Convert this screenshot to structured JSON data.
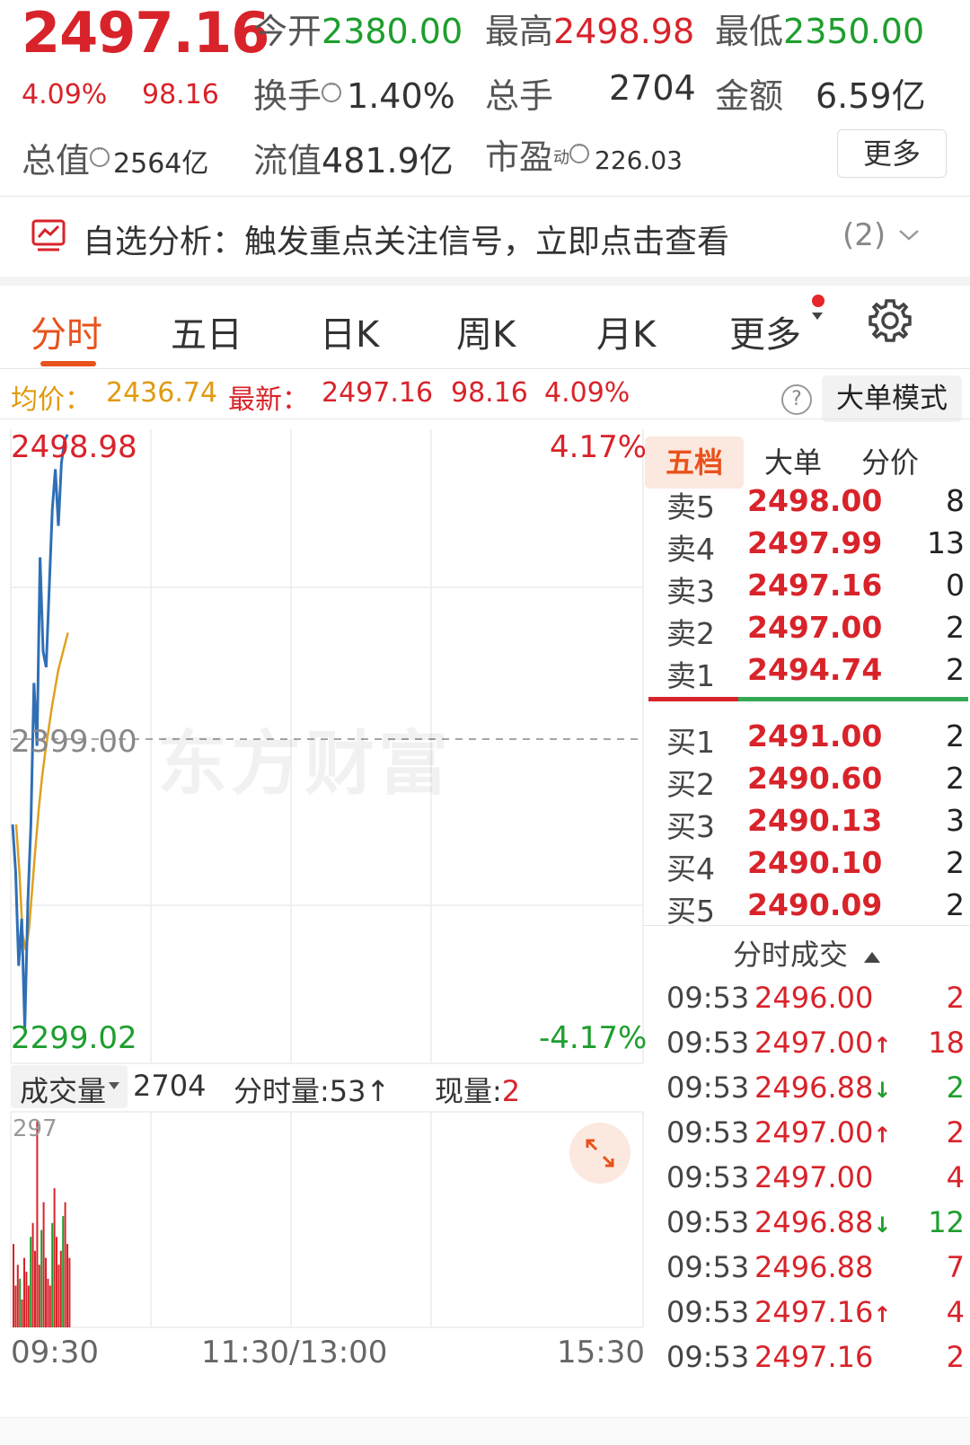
{
  "quote": {
    "price": "2497.16",
    "change_pct": "4.09%",
    "change_amt": "98.16",
    "open_label": "今开",
    "open_value": "2380.00",
    "high_label": "最高",
    "high_value": "2498.98",
    "low_label": "最低",
    "low_value": "2350.00",
    "turnover_label": "换手",
    "turnover_value": "1.40%",
    "volume_label": "总手",
    "volume_value": "2704",
    "amount_label": "金额",
    "amount_value": "6.59亿",
    "market_cap_label": "总值",
    "market_cap_value": "2564亿",
    "float_cap_label": "流值",
    "float_cap_value": "481.9亿",
    "pe_label": "市盈",
    "pe_superscript": "动",
    "pe_value": "226.03",
    "more_button": "更多"
  },
  "alert": {
    "text": "自选分析：触发重点关注信号，立即点击查看",
    "count": "(2)",
    "icon": "chart-alert-icon"
  },
  "tabs": [
    "分时",
    "五日",
    "日K",
    "周K",
    "月K",
    "更多"
  ],
  "active_tab": "分时",
  "info_line": {
    "avg_label": "均价：",
    "avg_value": "2436.74",
    "latest_label": "最新：",
    "latest_value": "2497.16",
    "change_amt": "98.16",
    "change_pct": "4.09%",
    "help_icon": "?",
    "big_order_button": "大单模式"
  },
  "chart": {
    "top_price": "2498.98",
    "top_pct": "4.17%",
    "mid_price": "2399.00",
    "bottom_price": "2299.02",
    "bottom_pct": "-4.17%",
    "watermark": "东方财富",
    "volume_label": "成交量",
    "volume_value": "2704",
    "minute_vol_label": "分时量:",
    "minute_vol_value": "53",
    "current_vol_label": "现量:",
    "current_vol_value": "2",
    "vol_axis_top": "297",
    "time_start": "09:30",
    "time_mid": "11:30/13:00",
    "time_end": "15:30",
    "colors": {
      "price_line": "#2f6fb5",
      "avg_line": "#e0a020",
      "up": "#d8232a",
      "down": "#1e9e2e"
    }
  },
  "chart_data": {
    "type": "line",
    "ylim": [
      2299.02,
      2498.98
    ],
    "y_reference": 2399.0,
    "series": [
      {
        "values": [
          2375,
          2360,
          2330,
          2345,
          2310,
          2350,
          2375,
          2420,
          2400,
          2460,
          2430,
          2425,
          2450,
          2475,
          2488,
          2470,
          2490,
          2497,
          2499
        ]
      },
      {
        "values": [
          2375,
          2360,
          2340,
          2335,
          2342,
          2355,
          2368,
          2380,
          2390,
          2398,
          2405,
          2412,
          2418,
          2424,
          2428,
          2432,
          2436
        ]
      }
    ],
    "volume": {
      "ylim": [
        0,
        297
      ],
      "bars": [
        120,
        60,
        90,
        70,
        40,
        100,
        80,
        60,
        130,
        150,
        110,
        297,
        90,
        140,
        180,
        100,
        70,
        60,
        150,
        200,
        130,
        90,
        110,
        160,
        180,
        120,
        100
      ]
    }
  },
  "book": {
    "tabs": [
      "五档",
      "大单",
      "分价"
    ],
    "sell": [
      {
        "label": "卖5",
        "price": "2498.00",
        "vol": "8"
      },
      {
        "label": "卖4",
        "price": "2497.99",
        "vol": "13"
      },
      {
        "label": "卖3",
        "price": "2497.16",
        "vol": "0"
      },
      {
        "label": "卖2",
        "price": "2497.00",
        "vol": "2"
      },
      {
        "label": "卖1",
        "price": "2494.74",
        "vol": "2"
      }
    ],
    "buy": [
      {
        "label": "买1",
        "price": "2491.00",
        "vol": "2"
      },
      {
        "label": "买2",
        "price": "2490.60",
        "vol": "2"
      },
      {
        "label": "买3",
        "price": "2490.13",
        "vol": "3"
      },
      {
        "label": "买4",
        "price": "2490.10",
        "vol": "2"
      },
      {
        "label": "买5",
        "price": "2490.09",
        "vol": "2"
      }
    ],
    "trades_header": "分时成交",
    "trades": [
      {
        "time": "09:53",
        "price": "2496.00",
        "dir": "",
        "vol": "2",
        "vol_color": "red"
      },
      {
        "time": "09:53",
        "price": "2497.00",
        "dir": "up",
        "vol": "18",
        "vol_color": "red"
      },
      {
        "time": "09:53",
        "price": "2496.88",
        "dir": "down",
        "vol": "2",
        "vol_color": "green"
      },
      {
        "time": "09:53",
        "price": "2497.00",
        "dir": "up",
        "vol": "2",
        "vol_color": "red"
      },
      {
        "time": "09:53",
        "price": "2497.00",
        "dir": "",
        "vol": "4",
        "vol_color": "red"
      },
      {
        "time": "09:53",
        "price": "2496.88",
        "dir": "down",
        "vol": "12",
        "vol_color": "green"
      },
      {
        "time": "09:53",
        "price": "2496.88",
        "dir": "",
        "vol": "7",
        "vol_color": "red"
      },
      {
        "time": "09:53",
        "price": "2497.16",
        "dir": "up",
        "vol": "4",
        "vol_color": "red"
      },
      {
        "time": "09:53",
        "price": "2497.16",
        "dir": "",
        "vol": "2",
        "vol_color": "red"
      }
    ]
  }
}
